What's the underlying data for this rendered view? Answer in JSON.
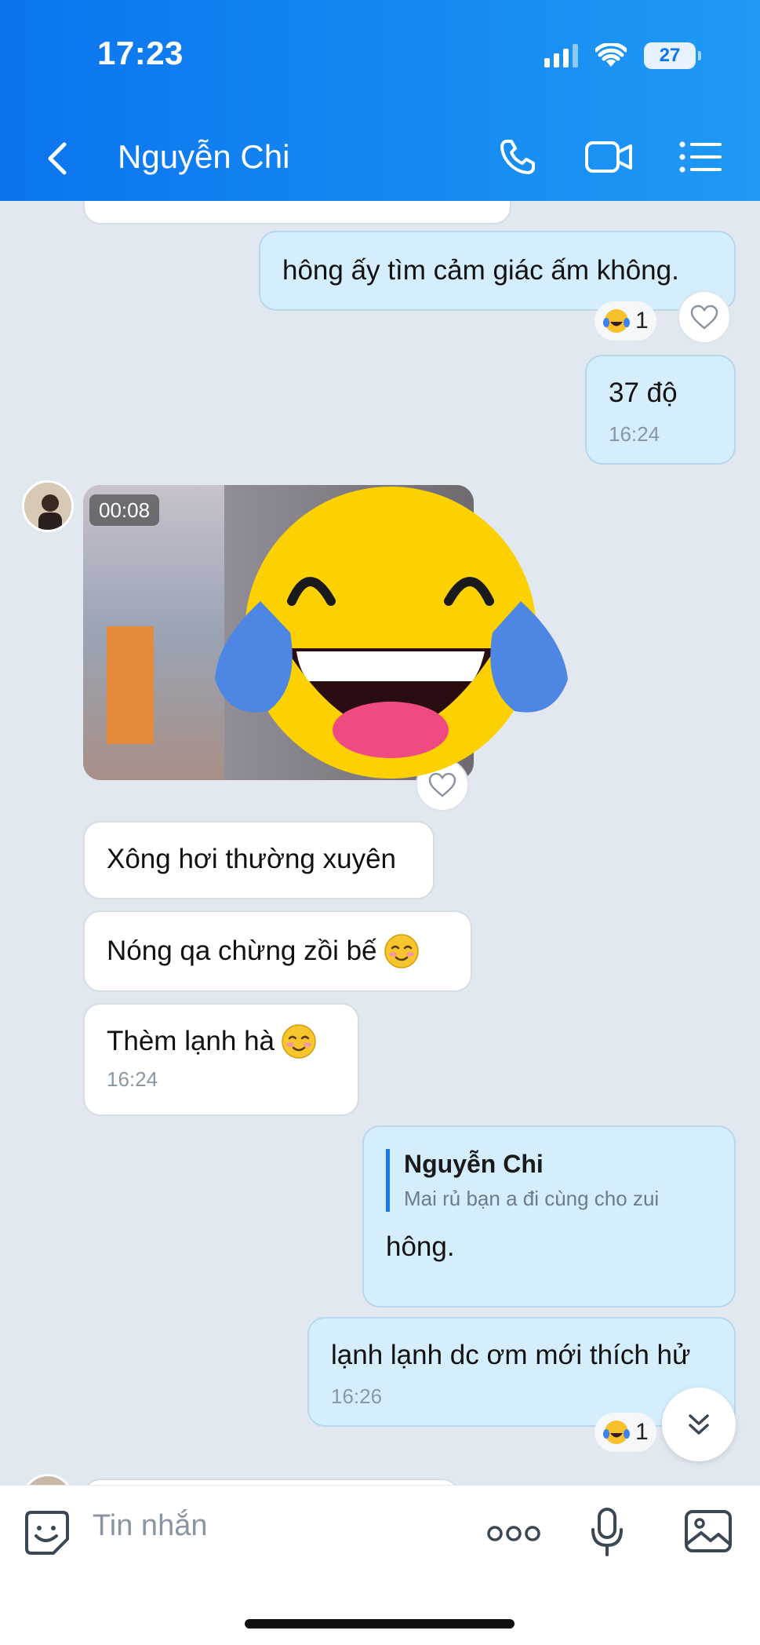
{
  "status_bar": {
    "time": "17:23",
    "battery": "27"
  },
  "header": {
    "title": "Nguyễn Chi"
  },
  "messages": {
    "m1": {
      "text": "hông ấy tìm cảm giác ấm không.",
      "reaction_count": "1"
    },
    "m2": {
      "text": "37 độ",
      "time": "16:24"
    },
    "video": {
      "duration": "00:08"
    },
    "m3": {
      "text": "Xông hơi thường xuyên"
    },
    "m4": {
      "text": "Nóng qa chừng zồi bế"
    },
    "m5": {
      "text": "Thèm lạnh hà",
      "time": "16:24"
    },
    "m6": {
      "quote_author": "Nguyễn Chi",
      "quote_text": "Mai  rủ bạn a đi cùng cho zui",
      "text": "hông."
    },
    "m7": {
      "text": "lạnh lạnh dc ơm mới thích hử",
      "time": "16:26",
      "reaction_count": "1"
    }
  },
  "input": {
    "placeholder": "Tin nhắn"
  },
  "icons": {
    "back": "chevron-left-icon",
    "call": "phone-icon",
    "video_call": "video-camera-icon",
    "menu": "list-icon",
    "sticker": "sticker-icon",
    "more": "more-dots-icon",
    "mic": "microphone-icon",
    "gallery": "image-icon",
    "heart": "heart-icon",
    "scroll": "chevron-double-down-icon",
    "laugh": "laughing-tears-emoji",
    "shy": "shy-smile-emoji"
  },
  "colors": {
    "header": "#0b74ee",
    "outgoing_bubble": "#d4eefd",
    "incoming_bubble": "#ffffff",
    "background": "#e2e8f0"
  }
}
